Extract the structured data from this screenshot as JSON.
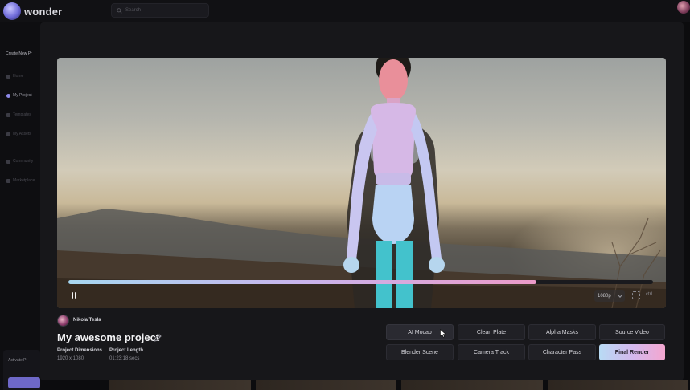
{
  "app": {
    "brand": "wonder",
    "search_placeholder": "Search"
  },
  "sidebar": {
    "create": "Create New Pr",
    "items": [
      {
        "label": "Home",
        "active": false
      },
      {
        "label": "My Project",
        "active": true
      },
      {
        "label": "Templates",
        "active": false
      },
      {
        "label": "My Assets",
        "active": false
      },
      {
        "label": "Community",
        "active": false
      },
      {
        "label": "Marketplace",
        "active": false
      }
    ],
    "promo": "Activate P"
  },
  "player": {
    "progress": 0.8,
    "quality": "1080p",
    "aspect": "ctrl"
  },
  "project": {
    "owner": "Nikola Tesla",
    "title": "My awesome project",
    "dimensions_label": "Project Dimensions",
    "dimensions_value": "1920 x 1080",
    "length_label": "Project Length",
    "length_value": "01:23:18 secs"
  },
  "actions": {
    "ai_mocap": "AI Mocap",
    "clean_plate": "Clean Plate",
    "alpha_masks": "Alpha Masks",
    "source_video": "Source Video",
    "blender_scene": "Blender Scene",
    "camera_track": "Camera Track",
    "character_pass": "Character Pass",
    "final_render": "Final Render"
  },
  "colors": {
    "accent_start": "#b8dbf4",
    "accent_mid": "#d3b9ee",
    "accent_end": "#f4a6cf",
    "modal_bg": "#17171a"
  }
}
